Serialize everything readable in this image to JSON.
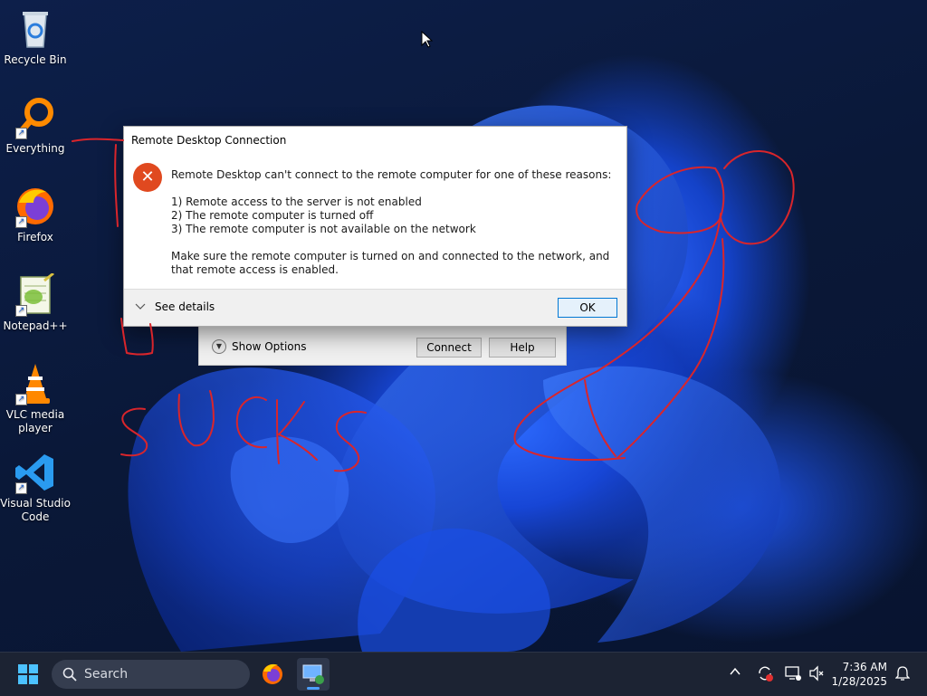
{
  "desktop": {
    "icons": [
      {
        "label": "Recycle Bin"
      },
      {
        "label": "Everything"
      },
      {
        "label": "Firefox"
      },
      {
        "label": "Notepad++"
      },
      {
        "label": "VLC media\nplayer"
      },
      {
        "label": "Visual Studio\nCode"
      }
    ]
  },
  "rdp_window": {
    "show_options": "Show Options",
    "connect": "Connect",
    "help": "Help"
  },
  "error_dialog": {
    "title": "Remote Desktop Connection",
    "heading": "Remote Desktop can't connect to the remote computer for one of these reasons:",
    "reasons": [
      "1) Remote access to the server is not enabled",
      "2) The remote computer is turned off",
      "3) The remote computer is not available on the network"
    ],
    "advice": "Make sure the remote computer is turned on and connected to the network, and that remote access is enabled.",
    "see_details": "See details",
    "ok": "OK"
  },
  "annotation": {
    "text": "SUCKS",
    "color": "#d9252b"
  },
  "taskbar": {
    "search_placeholder": "Search",
    "time": "7:36 AM",
    "date": "1/28/2025"
  }
}
